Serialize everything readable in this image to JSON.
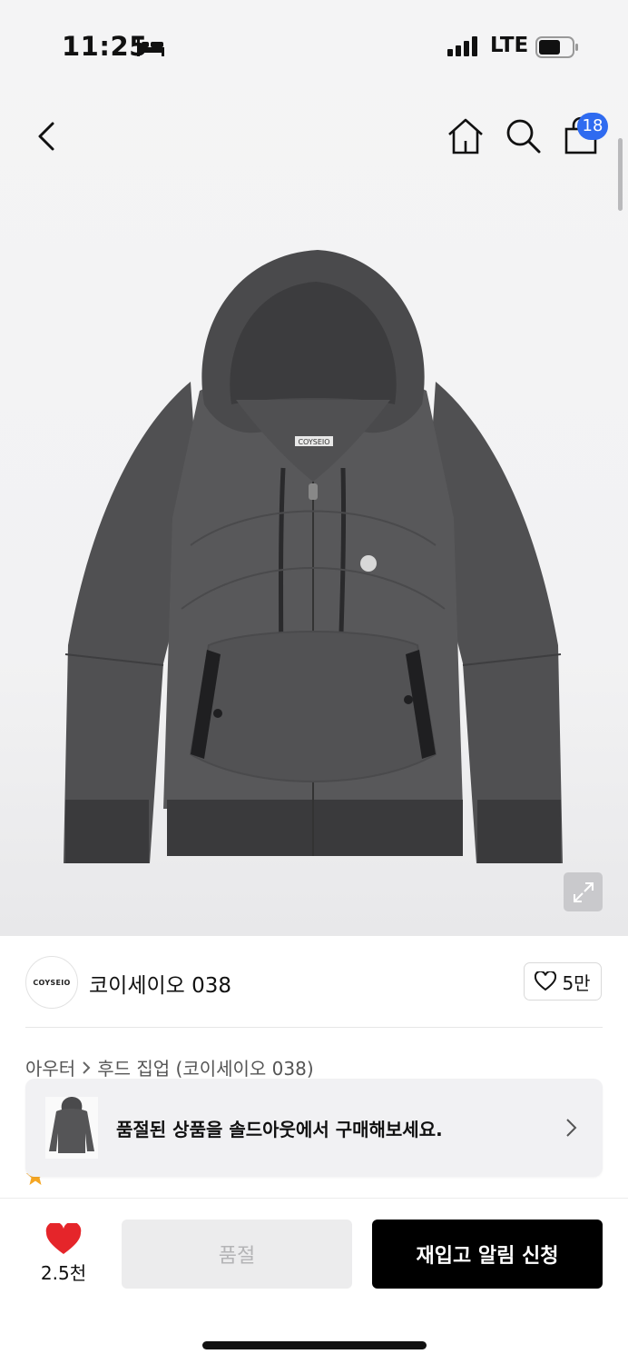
{
  "status_bar": {
    "time": "11:25",
    "network": "LTE"
  },
  "nav": {
    "cart_count": "18"
  },
  "product": {
    "label_tag": "COYSEIO",
    "logo_text": "COYSEIO"
  },
  "brand": {
    "name": "코이세이오 038",
    "likes": "5만",
    "logo_text": "COYSEIO"
  },
  "breadcrumb": {
    "category": "아우터",
    "subcategory": "후드 집업 (코이세이오 038)"
  },
  "toast": {
    "message": "품절된 상품을 솔드아웃에서 구매해보세요."
  },
  "bottom": {
    "like_count": "2.5천",
    "soldout_label": "품절",
    "restock_label": "재입고 알림 신청"
  },
  "colors": {
    "accent_blue": "#2f6bf0",
    "heart_red": "#e5252a",
    "primary_black": "#000000"
  }
}
